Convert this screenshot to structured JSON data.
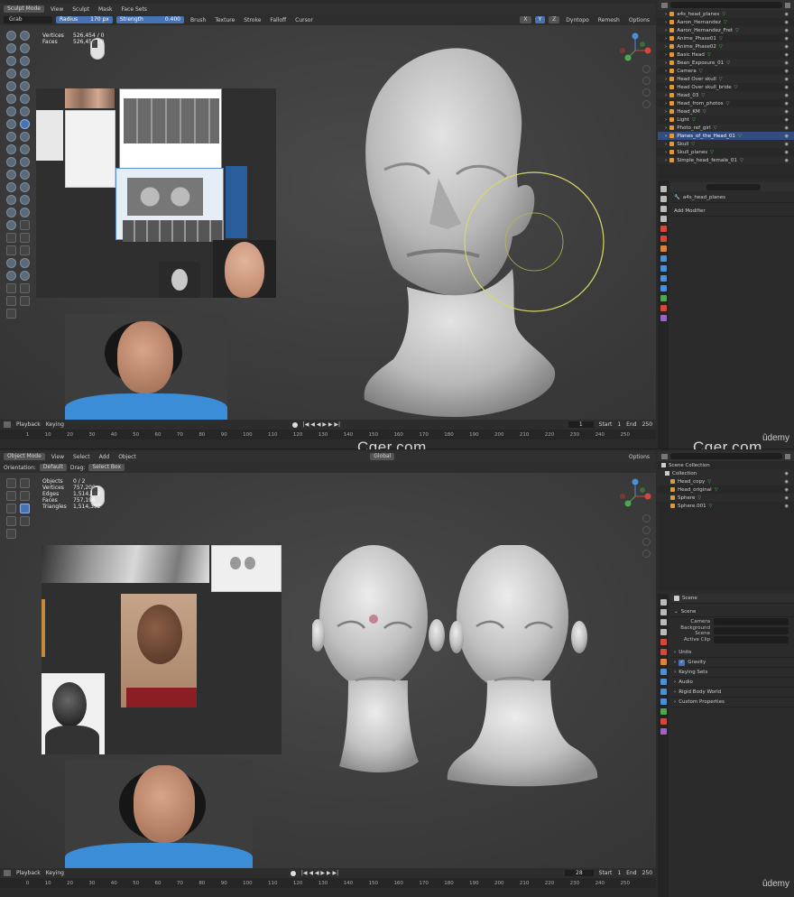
{
  "top": {
    "header": {
      "mode": "Sculpt Mode",
      "menus": [
        "View",
        "Sculpt",
        "Mask",
        "Face Sets"
      ],
      "brush_name": "Grab",
      "radius_label": "Radius",
      "radius_value": "170 px",
      "strength_label": "Strength",
      "strength_value": "0.400",
      "dropdowns": [
        "Brush",
        "Texture",
        "Stroke",
        "Falloff",
        "Cursor"
      ],
      "right_items": [
        "Dyntopo",
        "Remesh",
        "Options"
      ],
      "axis_xyz": [
        "X",
        "Y",
        "Z"
      ]
    },
    "stats": {
      "vertices_label": "Vertices",
      "vertices_value": "526,454 / 0",
      "faces_label": "Faces",
      "faces_value": "526,452 / 0"
    },
    "timeline": {
      "playback": "Playback",
      "keying": "Keying",
      "frame": "1",
      "start_label": "Start",
      "start_value": "1",
      "end_label": "End",
      "end_value": "250",
      "ticks": [
        "1",
        "10",
        "20",
        "30",
        "40",
        "50",
        "60",
        "70",
        "80",
        "90",
        "100",
        "110",
        "120",
        "130",
        "140",
        "150",
        "160",
        "170",
        "180",
        "190",
        "200",
        "210",
        "220",
        "230",
        "240",
        "250"
      ]
    },
    "outliner": {
      "items": [
        {
          "label": "a4s_head_planes",
          "selected": false
        },
        {
          "label": "Aaron_Hernandez",
          "selected": false
        },
        {
          "label": "Aaron_Hernandez_Fret",
          "selected": false
        },
        {
          "label": "Anime_Phase01",
          "selected": false
        },
        {
          "label": "Anime_Phase02",
          "selected": false
        },
        {
          "label": "Basic Head",
          "selected": false
        },
        {
          "label": "Bean_Exposure_01",
          "selected": false
        },
        {
          "label": "Camera",
          "selected": false
        },
        {
          "label": "Head Over skull",
          "selected": false
        },
        {
          "label": "Head Over skull_bride",
          "selected": false
        },
        {
          "label": "Head_03",
          "selected": false
        },
        {
          "label": "Head_from_photos",
          "selected": false
        },
        {
          "label": "Head_KM",
          "selected": false
        },
        {
          "label": "Light",
          "selected": false
        },
        {
          "label": "Photo_ref_girl",
          "selected": false
        },
        {
          "label": "Planes_of_the_Head_01",
          "selected": true
        },
        {
          "label": "Skull",
          "selected": false
        },
        {
          "label": "Skull_planes",
          "selected": false
        },
        {
          "label": "Simple_head_female_01",
          "selected": false
        }
      ]
    },
    "properties": {
      "object_name": "a4s_head_planes",
      "add_modifier": "Add Modifier"
    },
    "udemy": "ûdemy"
  },
  "watermarks": [
    "Cger.com",
    "Cger.com"
  ],
  "bottom": {
    "header": {
      "mode": "Object Mode",
      "menus": [
        "View",
        "Select",
        "Add",
        "Object"
      ],
      "orientation_label": "Orientation:",
      "orientation_value": "Default",
      "drag_label": "Drag:",
      "drag_value": "Select Box",
      "transform": "Global",
      "options": "Options"
    },
    "stats": {
      "objects_label": "Objects",
      "objects_value": "0 / 2",
      "vertices_label": "Vertices",
      "vertices_value": "757,200",
      "edges_label": "Edges",
      "edges_value": "1,514,392",
      "faces_label": "Faces",
      "faces_value": "757,196",
      "triangles_label": "Triangles",
      "triangles_value": "1,514,392"
    },
    "timeline": {
      "playback": "Playback",
      "keying": "Keying",
      "frame": "28",
      "start_label": "Start",
      "start_value": "1",
      "end_label": "End",
      "end_value": "250",
      "ticks": [
        "0",
        "10",
        "20",
        "30",
        "40",
        "50",
        "60",
        "70",
        "80",
        "90",
        "100",
        "110",
        "120",
        "130",
        "140",
        "150",
        "160",
        "170",
        "180",
        "190",
        "200",
        "210",
        "220",
        "230",
        "240",
        "250"
      ]
    },
    "outliner": {
      "scene_collection": "Scene Collection",
      "collection": "Collection",
      "items": [
        "Head_copy",
        "Head_original",
        "Sphere",
        "Sphere.001"
      ]
    },
    "properties": {
      "scene_title": "Scene",
      "scene_section": "Scene",
      "camera_label": "Camera",
      "bg_scene_label": "Background Scene",
      "active_clip_label": "Active Clip",
      "sections": [
        "Units",
        "Gravity",
        "Keying Sets",
        "Audio",
        "Rigid Body World",
        "Custom Properties"
      ]
    },
    "udemy": "ûdemy"
  },
  "colors": {
    "accent": "#4772b3",
    "brush_circle": "#d8d86a",
    "selected_row": "#334d80"
  }
}
